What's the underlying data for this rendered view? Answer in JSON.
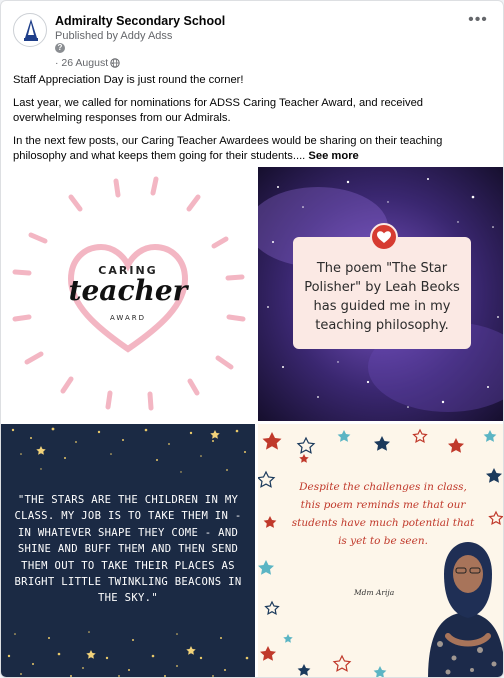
{
  "post": {
    "page_name": "Admiralty Secondary School",
    "published_by": "Published by Addy Adss",
    "help_badge": "?",
    "date": "· 26 August ·",
    "more_label": "•••",
    "paragraphs": [
      "Staff Appreciation Day is just round the corner!",
      "Last year, we called for nominations for ADSS Caring Teacher Award, and received overwhelming responses from our Admirals.",
      "In the next few posts, our Caring Teacher Awardees would be sharing on their teaching philosophy and what keeps them going for their students...."
    ],
    "see_more": "See more"
  },
  "images": {
    "award": {
      "caring": "CARING",
      "teacher": "teacher",
      "award": "AWARD"
    },
    "poem": {
      "text": "The poem \"The Star Polisher\" by Leah Beoks has guided me in my teaching philosophy."
    },
    "quote": {
      "text": "\"THE STARS ARE THE CHILDREN IN MY CLASS. MY JOB IS TO TAKE THEM IN - IN WHATEVER SHAPE THEY COME - AND SHINE AND BUFF THEM AND THEN SEND THEM OUT TO TAKE THEIR PLACES AS BRIGHT LITTLE TWINKLING BEACONS IN THE SKY.\""
    },
    "teacher": {
      "text": "Despite the challenges in class, this poem reminds me that our students have much potential that is yet to be seen.",
      "signature": "Mdm Arija"
    }
  },
  "colors": {
    "heart_pink": "#f3b6c3",
    "star_gold": "#e8c86a",
    "poem_red": "#c0392b"
  },
  "icons": [
    "school-crest-icon",
    "help-icon",
    "globe-icon",
    "more-options-icon",
    "heart-icon",
    "star-icon"
  ]
}
